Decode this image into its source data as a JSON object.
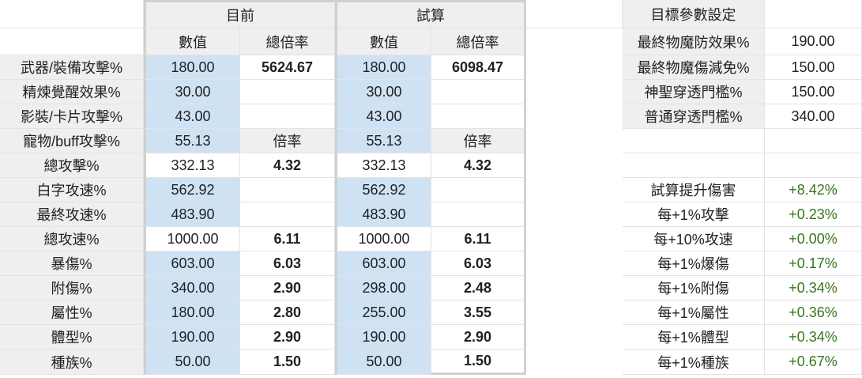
{
  "headers": {
    "current": "目前",
    "trial": "試算",
    "target_settings": "目標參數設定",
    "value": "數值",
    "total_multiplier": "總倍率",
    "multiplier": "倍率"
  },
  "rows": [
    {
      "label": "武器/裝備攻擊%",
      "cur_val": "180.00",
      "cur_mult": "5624.67",
      "trial_val": "180.00",
      "trial_mult": "6098.47"
    },
    {
      "label": "精煉覺醒效果%",
      "cur_val": "30.00",
      "cur_mult": "",
      "trial_val": "30.00",
      "trial_mult": ""
    },
    {
      "label": "影裝/卡片攻擊%",
      "cur_val": "43.00",
      "cur_mult": "",
      "trial_val": "43.00",
      "trial_mult": ""
    },
    {
      "label": "寵物/buff攻擊%",
      "cur_val": "55.13",
      "cur_mult": "倍率",
      "trial_val": "55.13",
      "trial_mult": "倍率"
    },
    {
      "label": "總攻擊%",
      "cur_val": "332.13",
      "cur_mult": "4.32",
      "trial_val": "332.13",
      "trial_mult": "4.32"
    },
    {
      "label": "白字攻速%",
      "cur_val": "562.92",
      "cur_mult": "",
      "trial_val": "562.92",
      "trial_mult": ""
    },
    {
      "label": "最終攻速%",
      "cur_val": "483.90",
      "cur_mult": "",
      "trial_val": "483.90",
      "trial_mult": ""
    },
    {
      "label": "總攻速%",
      "cur_val": "1000.00",
      "cur_mult": "6.11",
      "trial_val": "1000.00",
      "trial_mult": "6.11"
    },
    {
      "label": "暴傷%",
      "cur_val": "603.00",
      "cur_mult": "6.03",
      "trial_val": "603.00",
      "trial_mult": "6.03"
    },
    {
      "label": "附傷%",
      "cur_val": "340.00",
      "cur_mult": "2.90",
      "trial_val": "298.00",
      "trial_mult": "2.48"
    },
    {
      "label": "屬性%",
      "cur_val": "180.00",
      "cur_mult": "2.80",
      "trial_val": "255.00",
      "trial_mult": "3.55"
    },
    {
      "label": "體型%",
      "cur_val": "190.00",
      "cur_mult": "2.90",
      "trial_val": "190.00",
      "trial_mult": "2.90"
    },
    {
      "label": "種族%",
      "cur_val": "50.00",
      "cur_mult": "1.50",
      "trial_val": "50.00",
      "trial_mult": "1.50"
    }
  ],
  "targets": [
    {
      "label": "最終物魔防效果%",
      "value": "190.00"
    },
    {
      "label": "最終物魔傷減免%",
      "value": "150.00"
    },
    {
      "label": "神聖穿透門檻%",
      "value": "150.00"
    },
    {
      "label": "普通穿透門檻%",
      "value": "340.00"
    }
  ],
  "gains": [
    {
      "label": "試算提升傷害",
      "value": "+8.42%"
    },
    {
      "label": "每+1%攻擊",
      "value": "+0.23%"
    },
    {
      "label": "每+10%攻速",
      "value": "+0.00%"
    },
    {
      "label": "每+1%爆傷",
      "value": "+0.17%"
    },
    {
      "label": "每+1%附傷",
      "value": "+0.34%"
    },
    {
      "label": "每+1%屬性",
      "value": "+0.36%"
    },
    {
      "label": "每+1%體型",
      "value": "+0.34%"
    },
    {
      "label": "每+1%種族",
      "value": "+0.67%"
    }
  ],
  "colors": {
    "input_blue": "#cfe2f3",
    "header_grey": "#efefef",
    "gain_green": "#38761d"
  }
}
